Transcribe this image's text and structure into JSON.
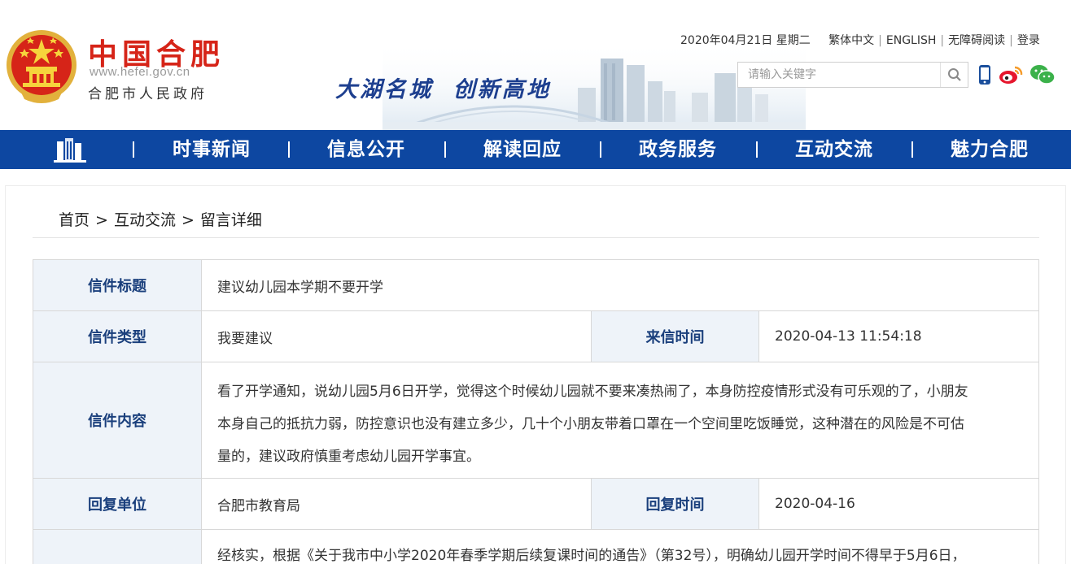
{
  "header": {
    "logo_name": "中国合肥",
    "logo_url": "www.hefei.gov.cn",
    "logo_subtitle": "合肥市人民政府",
    "slogan": "大湖名城  创新高地",
    "date": "2020年04月21日 星期二",
    "links": [
      "繁体中文",
      "ENGLISH",
      "无障碍阅读",
      "登录"
    ],
    "search_placeholder": "请输入关键字",
    "social_icons": [
      "mobile-icon",
      "weibo-icon",
      "wechat-icon"
    ]
  },
  "nav": {
    "home_icon": "city-building-icon",
    "items": [
      "时事新闻",
      "信息公开",
      "解读回应",
      "政务服务",
      "互动交流",
      "魅力合肥"
    ]
  },
  "breadcrumb": {
    "items": [
      "首页",
      "互动交流",
      "留言详细"
    ]
  },
  "letter": {
    "title_label": "信件标题",
    "title": "建议幼儿园本学期不要开学",
    "type_label": "信件类型",
    "type": "我要建议",
    "time_label": "来信时间",
    "time": "2020-04-13 11:54:18",
    "content_label": "信件内容",
    "content_lines": [
      "看了开学通知，说幼儿园5月6日开学，觉得这个时候幼儿园就不要来凑热闹了，本身防控疫情形式没有可乐观的了，小朋友",
      "本身自己的抵抗力弱，防控意识也没有建立多少，几十个小朋友带着口罩在一个空间里吃饭睡觉，这种潜在的风险是不可估",
      "量的，建议政府慎重考虑幼儿园开学事宜。"
    ],
    "reply_unit_label": "回复单位",
    "reply_unit": "合肥市教育局",
    "reply_time_label": "回复时间",
    "reply_time": "2020-04-16",
    "reply_content_line": "经核实，根据《关于我市中小学2020年春季学期后续复课时间的通告》（第32号），明确幼儿园开学时间不得早于5月6日，"
  },
  "colors": {
    "brand_red": "#d62418",
    "nav_blue": "#0d47a1",
    "label_bg": "#eef3f9",
    "label_text": "#1a3f7c"
  }
}
